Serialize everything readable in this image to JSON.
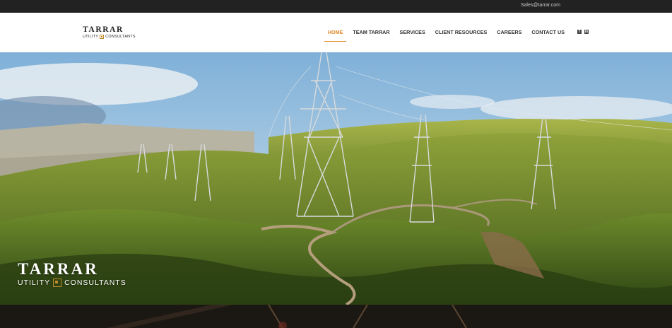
{
  "topbar": {
    "email": "Sales@tarrar.com"
  },
  "header": {
    "logo_line1": "TARRAR",
    "logo_line2_left": "UTILITY",
    "logo_line2_right": "CONSULTANTS"
  },
  "nav": {
    "items": [
      {
        "label": "HOME",
        "active": true
      },
      {
        "label": "TEAM TARRAR"
      },
      {
        "label": "SERVICES"
      },
      {
        "label": "CLIENT RESOURCES"
      },
      {
        "label": "CAREERS"
      },
      {
        "label": "CONTACT US"
      }
    ],
    "social": [
      {
        "icon": "facebook-icon"
      },
      {
        "icon": "linkedin-icon"
      }
    ]
  },
  "hero": {
    "logo_line1": "TARRAR",
    "logo_line2_left": "UTILITY",
    "logo_line2_right": "CONSULTANTS"
  },
  "colors": {
    "accent": "#e0872c",
    "topbar": "#222222",
    "badge": "#c08a2a"
  }
}
